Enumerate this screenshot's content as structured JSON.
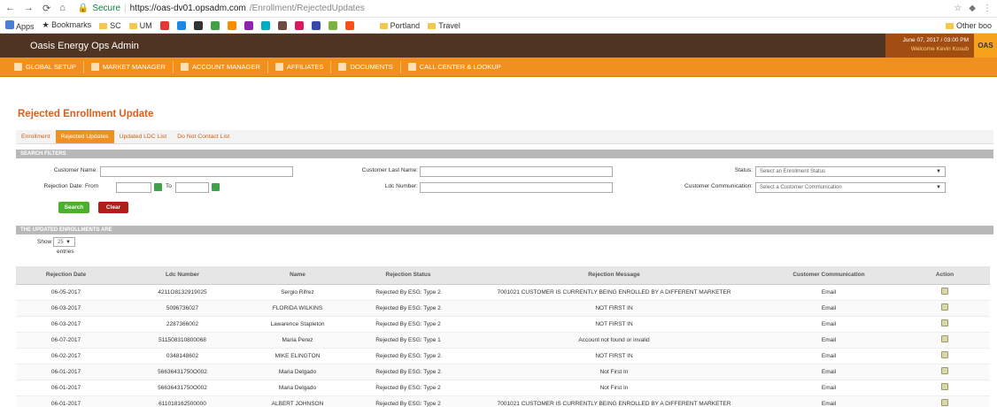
{
  "browser": {
    "secure_label": "Secure",
    "url_host": "https://oas-dv01.opsadm.com",
    "url_path": "/Enrollment/RejectedUpdates",
    "bookmarks": [
      "Apps",
      "Bookmarks",
      "SC",
      "UM",
      "Portland",
      "Travel"
    ],
    "other_bookmarks": "Other boo"
  },
  "header": {
    "title": "Oasis Energy Ops Admin",
    "date": "June 07, 2017 / 03:00 PM",
    "welcome": "Welcome  Kevin Kosub",
    "logo": "OAS"
  },
  "nav": {
    "items": [
      "GLOBAL SETUP",
      "MARKET MANAGER",
      "ACCOUNT MANAGER",
      "AFFILIATES",
      "DOCUMENTS",
      "CALL CENTER & LOOKUP"
    ]
  },
  "page": {
    "title": "Rejected Enrollment Update",
    "tabs": [
      "Enrollment",
      "Rejected Updates",
      "Updated LDC List",
      "Do Not Contact List"
    ],
    "active_tab": 1
  },
  "filters": {
    "section_title": "SEARCH FILTERS",
    "customer_name_label": "Customer Name:",
    "customer_last_name_label": "Customer Last Name:",
    "status_label": "Status:",
    "status_placeholder": "Select an Enrollment Status",
    "rejection_date_label": "Rejection Date:",
    "from_label": "From",
    "to_label": "To",
    "ldc_number_label": "Ldc Number:",
    "communication_label": "Customer Communication:",
    "communication_placeholder": "Select a Customer Communication",
    "search_button": "Search",
    "clear_button": "Clear"
  },
  "results": {
    "section_title": "THE UPDATED ENROLLMENTS ARE",
    "show_label": "Show",
    "show_value": "25",
    "entries_label": "entries",
    "columns": [
      "Rejection Date",
      "Ldc Number",
      "Name",
      "Rejection Status",
      "Rejection Message",
      "Customer Communication",
      "Action"
    ],
    "rows": [
      [
        "06-05-2017",
        "4211O8132919025",
        "Sergio Rifrez",
        "Rejected By ESG: Type 2",
        "7001021 CUSTOMER IS CURRENTLY BEING ENROLLED BY A DIFFERENT MARKETER",
        "Email"
      ],
      [
        "06-03-2017",
        "5096736027",
        "FLORIDA WILKINS",
        "Rejected By ESG: Type 2",
        "NOT FIRST IN",
        "Email"
      ],
      [
        "06-03-2017",
        "2287366002",
        "Lawarence Stapleton",
        "Rejected By ESG: Type 2",
        "NOT FIRST IN",
        "Email"
      ],
      [
        "06-07-2017",
        "511508310800068",
        "Maria Perez",
        "Rejected By ESG: Type 1",
        "Account not found or invalid",
        "Email"
      ],
      [
        "06-02-2017",
        "0348148602",
        "MIKE ELINGTON",
        "Rejected By ESG: Type 2",
        "NOT FIRST IN",
        "Email"
      ],
      [
        "06-01-2017",
        "56636431750O002",
        "Maria Delgado",
        "Rejected By ESG: Type 2",
        "Not First In",
        "Email"
      ],
      [
        "06-01-2017",
        "56636431750O002",
        "Maria Delgado",
        "Rejected By ESG: Type 2",
        "Not First In",
        "Email"
      ],
      [
        "06-01-2017",
        "611018162500000",
        "ALBERT JOHNSON",
        "Rejected By ESG: Type 2",
        "7001021 CUSTOMER IS CURRENTLY BEING ENROLLED BY A DIFFERENT MARKETER",
        "Email"
      ]
    ]
  },
  "colors": {
    "brand_brown": "#4e3421",
    "nav_orange": "#f0901e",
    "title_orange": "#d9601a",
    "search_green": "#4caf2d",
    "clear_red": "#b01e1a"
  }
}
